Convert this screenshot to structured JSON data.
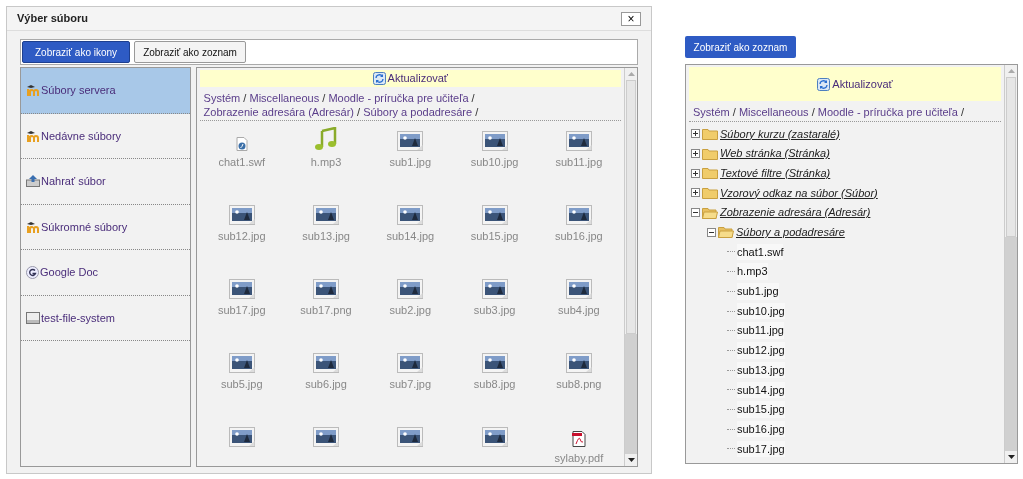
{
  "dialog": {
    "title": "Výber súboru",
    "close": "×",
    "view_buttons": [
      {
        "label": "Zobraziť ako ikony",
        "selected": true
      },
      {
        "label": "Zobraziť ako zoznam",
        "selected": false
      }
    ],
    "sidebar": {
      "items": [
        {
          "label": "Súbory servera",
          "kind": "moodle",
          "selected": true
        },
        {
          "label": "Nedávne súbory",
          "kind": "moodle",
          "selected": false
        },
        {
          "label": "Nahrať súbor",
          "kind": "upload",
          "selected": false
        },
        {
          "label": "Súkromné súbory",
          "kind": "moodle",
          "selected": false
        },
        {
          "label": "Google Doc",
          "kind": "google",
          "selected": false
        },
        {
          "label": "test-file-system",
          "kind": "drive",
          "selected": false
        }
      ]
    },
    "refresh": "Aktualizovať",
    "breadcrumb": [
      {
        "kind": "link",
        "text": "Systém"
      },
      {
        "kind": "separator",
        "text": "/"
      },
      {
        "kind": "link",
        "text": "Miscellaneous"
      },
      {
        "kind": "separator",
        "text": "/"
      },
      {
        "kind": "link",
        "text": "Moodle - príručka pre učiteľa"
      },
      {
        "kind": "separator",
        "text": "/"
      },
      {
        "kind": "link",
        "text": "Zobrazenie adresára (Adresár)"
      },
      {
        "kind": "separator",
        "text": "/"
      },
      {
        "kind": "link",
        "text": "Súbory a podadresáre"
      },
      {
        "kind": "separator",
        "text": "/"
      }
    ],
    "files": [
      {
        "kind": "swf",
        "name": "chat1.swf"
      },
      {
        "kind": "audio",
        "name": "h.mp3"
      },
      {
        "kind": "image",
        "name": "sub1.jpg"
      },
      {
        "kind": "image",
        "name": "sub10.jpg"
      },
      {
        "kind": "image",
        "name": "sub11.jpg"
      },
      {
        "kind": "image",
        "name": "sub12.jpg"
      },
      {
        "kind": "image",
        "name": "sub13.jpg"
      },
      {
        "kind": "image",
        "name": "sub14.jpg"
      },
      {
        "kind": "image",
        "name": "sub15.jpg"
      },
      {
        "kind": "image",
        "name": "sub16.jpg"
      },
      {
        "kind": "image",
        "name": "sub17.jpg"
      },
      {
        "kind": "image",
        "name": "sub17.png"
      },
      {
        "kind": "image",
        "name": "sub2.jpg"
      },
      {
        "kind": "image",
        "name": "sub3.jpg"
      },
      {
        "kind": "image",
        "name": "sub4.jpg"
      },
      {
        "kind": "image",
        "name": "sub5.jpg"
      },
      {
        "kind": "image",
        "name": "sub6.jpg"
      },
      {
        "kind": "image",
        "name": "sub7.jpg"
      },
      {
        "kind": "image",
        "name": "sub8.jpg"
      },
      {
        "kind": "image",
        "name": "sub8.png"
      },
      {
        "kind": "image"
      },
      {
        "kind": "image"
      },
      {
        "kind": "image"
      },
      {
        "kind": "image"
      },
      {
        "kind": "pdf",
        "name": "sylaby.pdf"
      }
    ]
  },
  "list_view": {
    "button": {
      "label": "Zobraziť ako zoznam",
      "selected": true
    },
    "refresh": "Aktualizovať",
    "breadcrumb": [
      {
        "kind": "link",
        "text": "Systém"
      },
      {
        "kind": "separator",
        "text": "/"
      },
      {
        "kind": "link",
        "text": "Miscellaneous"
      },
      {
        "kind": "separator",
        "text": "/"
      },
      {
        "kind": "link",
        "text": "Moodle - príručka pre učiteľa"
      },
      {
        "kind": "separator",
        "text": "/"
      }
    ],
    "tree": [
      {
        "kind": "folder",
        "label": "Súbory kurzu (zastaralé)",
        "expanded": false
      },
      {
        "kind": "folder",
        "label": "Web stránka (Stránka)",
        "expanded": false
      },
      {
        "kind": "folder",
        "label": "Textové filtre (Stránka)",
        "expanded": false
      },
      {
        "kind": "folder",
        "label": "Vzorový odkaz na súbor (Súbor)",
        "expanded": false
      },
      {
        "kind": "folder",
        "label": "Zobrazenie adresára (Adresár)",
        "expanded": true,
        "children": [
          {
            "kind": "folder",
            "label": "Súbory a podadresáre",
            "expanded": true,
            "children": [
              {
                "kind": "file",
                "label": "chat1.swf"
              },
              {
                "kind": "file",
                "label": "h.mp3"
              },
              {
                "kind": "file",
                "label": "sub1.jpg"
              },
              {
                "kind": "file",
                "label": "sub10.jpg"
              },
              {
                "kind": "file",
                "label": "sub11.jpg"
              },
              {
                "kind": "file",
                "label": "sub12.jpg"
              },
              {
                "kind": "file",
                "label": "sub13.jpg"
              },
              {
                "kind": "file",
                "label": "sub14.jpg"
              },
              {
                "kind": "file",
                "label": "sub15.jpg"
              },
              {
                "kind": "file",
                "label": "sub16.jpg"
              },
              {
                "kind": "file",
                "label": "sub17.jpg"
              }
            ]
          }
        ]
      }
    ]
  }
}
